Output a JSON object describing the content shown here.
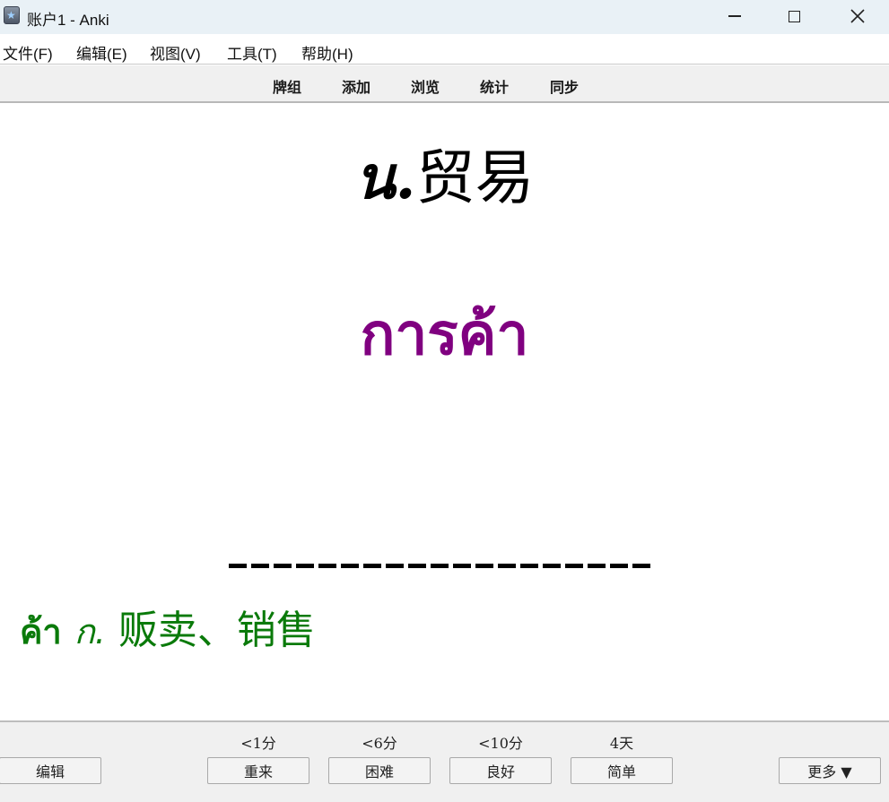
{
  "window": {
    "title": "账户1 - Anki"
  },
  "menu": [
    "文件(F)",
    "编辑(E)",
    "视图(V)",
    "工具(T)",
    "帮助(H)"
  ],
  "toolbar": {
    "decks": "牌组",
    "add": "添加",
    "browse": "浏览",
    "stats": "统计",
    "sync": "同步"
  },
  "card": {
    "word_pos": "น.",
    "word_meaning": "贸易",
    "thai_word": "การค้า",
    "divider": "--------------------",
    "example_thai": "ค้า",
    "example_pos": "ก.",
    "example_meaning": "贩卖、销售",
    "colors": {
      "thai_word": "#800080",
      "example": "#0a7a0a"
    }
  },
  "answer_bar": {
    "edit_label": "编辑",
    "more_label": "更多 ▼",
    "buttons": [
      {
        "label": "重来",
        "interval": "<1分"
      },
      {
        "label": "困难",
        "interval": "<6分"
      },
      {
        "label": "良好",
        "interval": "<10分"
      },
      {
        "label": "简单",
        "interval": "4天"
      }
    ]
  },
  "icons": {
    "app": "anki-star-icon",
    "minimize": "minimize-icon",
    "maximize": "maximize-icon",
    "close": "close-icon"
  }
}
